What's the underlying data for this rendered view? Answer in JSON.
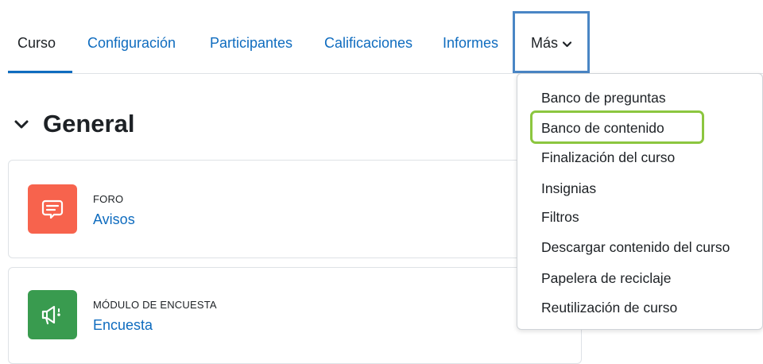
{
  "tabs": [
    {
      "label": "Curso",
      "active": true
    },
    {
      "label": "Configuración"
    },
    {
      "label": "Participantes"
    },
    {
      "label": "Calificaciones"
    },
    {
      "label": "Informes"
    }
  ],
  "more": {
    "label": "Más",
    "icon": "chevron-down-icon"
  },
  "section": {
    "title": "General",
    "icon": "chevron-down-icon"
  },
  "activities": [
    {
      "type": "FORO",
      "name": "Avisos",
      "icon": "forum-icon",
      "color": "#f7634d"
    },
    {
      "type": "MÓDULO DE ENCUESTA",
      "name": "Encuesta",
      "icon": "megaphone-icon",
      "color": "#399b4f"
    }
  ],
  "dropdown": {
    "items": [
      "Banco de preguntas",
      "Banco de contenido",
      "Finalización del curso",
      "Insignias",
      "Filtros",
      "Descargar contenido del curso",
      "Papelera de reciclaje",
      "Reutilización de curso"
    ],
    "highlighted_index": 1
  },
  "colors": {
    "link": "#0f6cbf",
    "highlight": "#8cc63f",
    "focus_box": "#4a86c5"
  }
}
